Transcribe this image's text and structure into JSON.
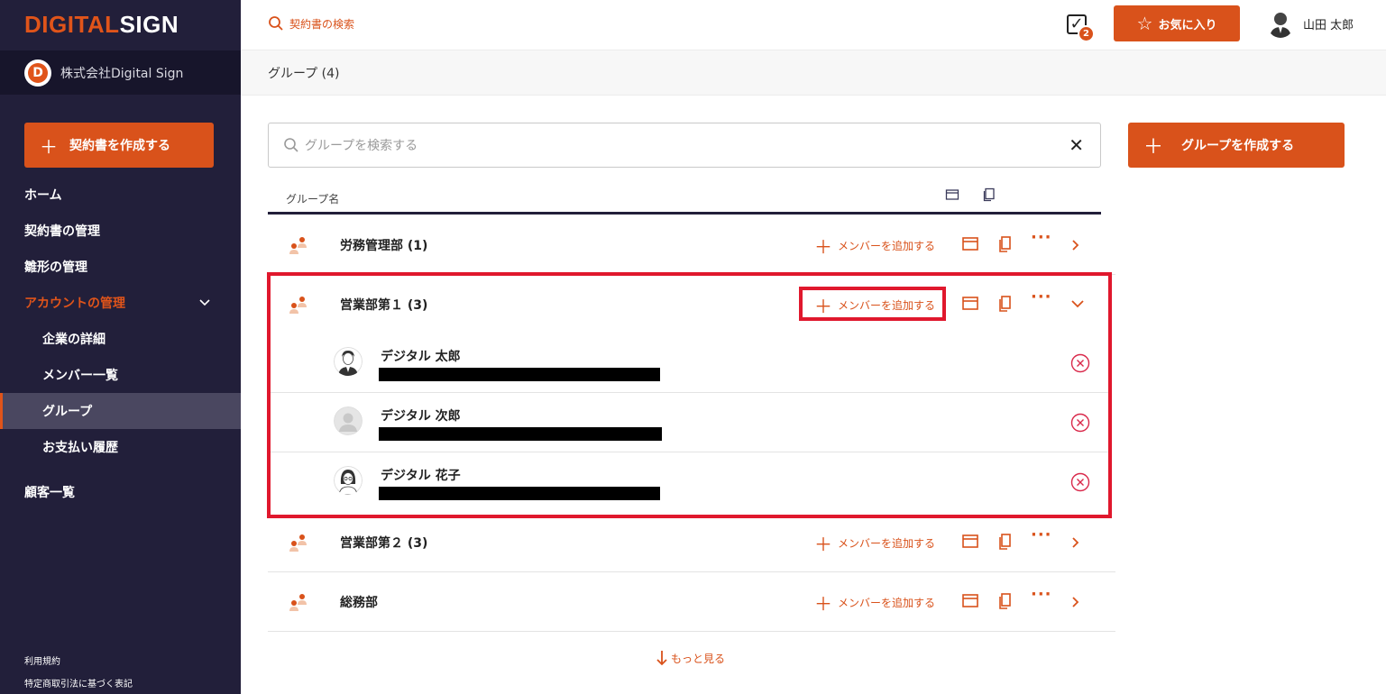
{
  "brand": {
    "part1": "DIGITAL",
    "part2": "SIGN"
  },
  "company": {
    "initial": "D",
    "name": "株式会社Digital Sign"
  },
  "sidebar": {
    "create_label": "契約書を作成する",
    "items": [
      {
        "label": "ホーム"
      },
      {
        "label": "契約書の管理"
      },
      {
        "label": "雛形の管理"
      },
      {
        "label": "アカウントの管理"
      },
      {
        "label": "企業の詳細"
      },
      {
        "label": "メンバー一覧"
      },
      {
        "label": "グループ"
      },
      {
        "label": "お支払い履歴"
      },
      {
        "label": "顧客一覧"
      }
    ],
    "footer": {
      "terms": "利用規約",
      "legal": "特定商取引法に基づく表記"
    }
  },
  "header": {
    "search_label": "契約書の検索",
    "notification_count": "2",
    "favorites_label": "お気に入り",
    "user_name": "山田 太郎"
  },
  "breadcrumb": {
    "title": "グループ (4)"
  },
  "group_search": {
    "placeholder": "グループを検索する"
  },
  "create_group_label": "グループを作成する",
  "table": {
    "header_name": "グループ名"
  },
  "add_member_label": "メンバーを追加する",
  "groups": [
    {
      "name": "労務管理部 (1)",
      "expanded": false
    },
    {
      "name": "営業部第１ (3)",
      "expanded": true,
      "members": [
        {
          "name": "デジタル 太郎",
          "avatar": "male"
        },
        {
          "name": "デジタル 次郎",
          "avatar": "placeholder"
        },
        {
          "name": "デジタル 花子",
          "avatar": "female"
        }
      ]
    },
    {
      "name": "営業部第２ (3)",
      "expanded": false
    },
    {
      "name": "総務部",
      "expanded": false
    }
  ],
  "see_more_label": "もっと見る",
  "colors": {
    "accent": "#d9521b",
    "sidebar": "#221f3a",
    "highlight": "#e0182d"
  }
}
